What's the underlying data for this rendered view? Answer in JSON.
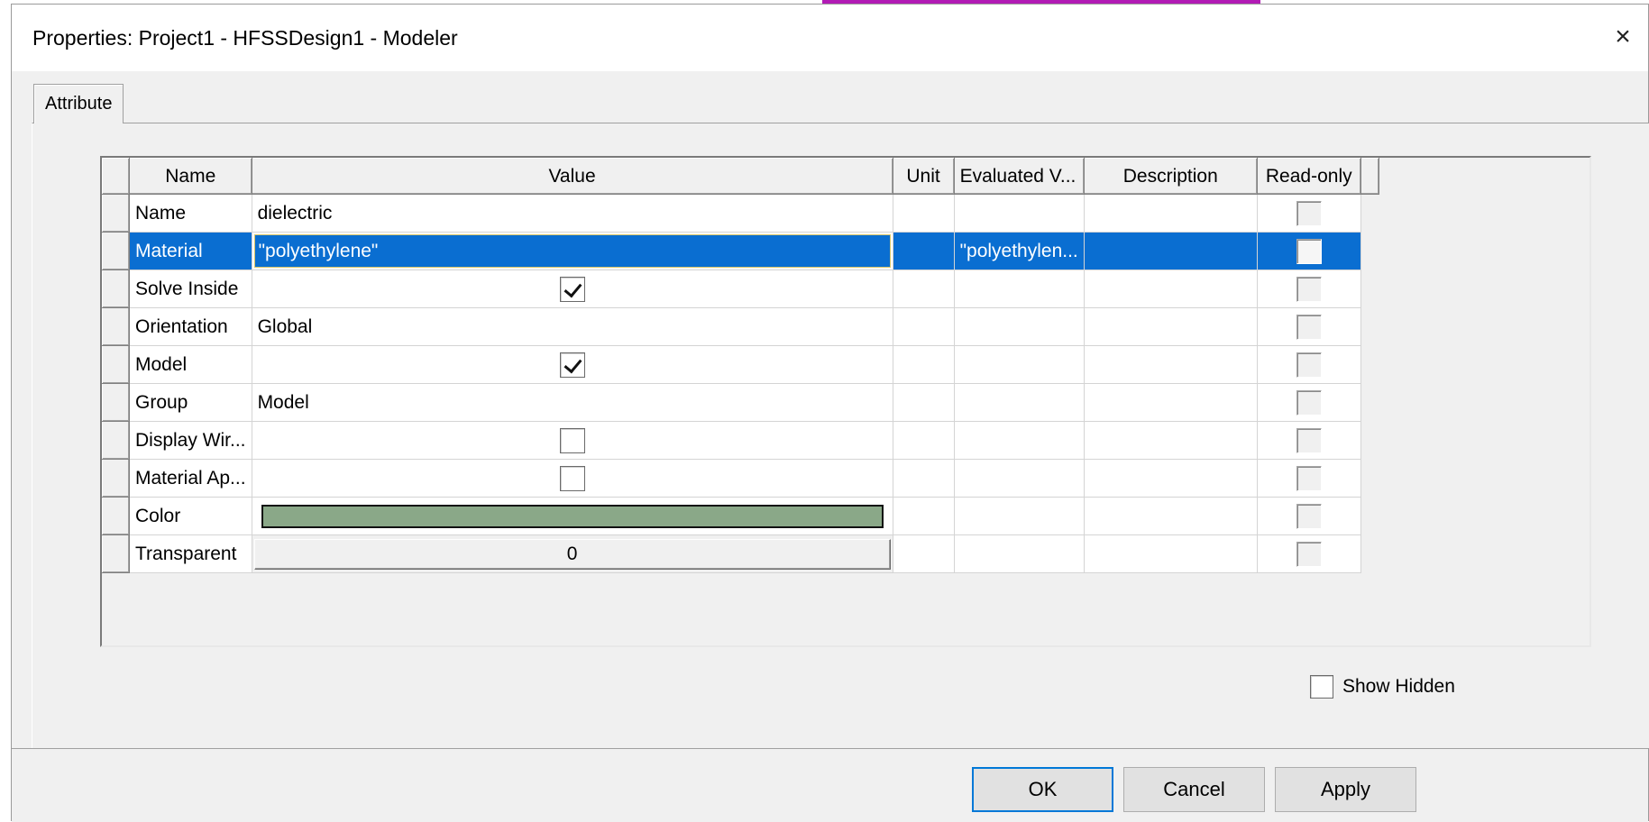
{
  "window": {
    "title": "Properties: Project1 - HFSSDesign1 - Modeler",
    "close_glyph": "×"
  },
  "tabs": [
    {
      "label": "Attribute",
      "active": true
    }
  ],
  "grid": {
    "columns": [
      "Name",
      "Value",
      "Unit",
      "Evaluated V...",
      "Description",
      "Read-only"
    ],
    "rows": [
      {
        "name": "Name",
        "value_type": "text",
        "value": "dielectric",
        "unit": "",
        "evaluated": "",
        "description": "",
        "read_only": false
      },
      {
        "name": "Material",
        "value_type": "edit",
        "value": "\"polyethylene\"",
        "unit": "",
        "evaluated": "\"polyethylen...",
        "description": "",
        "read_only": false,
        "selected": true
      },
      {
        "name": "Solve Inside",
        "value_type": "checkbox",
        "checked": true,
        "unit": "",
        "evaluated": "",
        "description": "",
        "read_only": false
      },
      {
        "name": "Orientation",
        "value_type": "text",
        "value": "Global",
        "unit": "",
        "evaluated": "",
        "description": "",
        "read_only": false
      },
      {
        "name": "Model",
        "value_type": "checkbox",
        "checked": true,
        "unit": "",
        "evaluated": "",
        "description": "",
        "read_only": false
      },
      {
        "name": "Group",
        "value_type": "text",
        "value": "Model",
        "unit": "",
        "evaluated": "",
        "description": "",
        "read_only": false
      },
      {
        "name": "Display Wir...",
        "value_type": "checkbox",
        "checked": false,
        "unit": "",
        "evaluated": "",
        "description": "",
        "read_only": false
      },
      {
        "name": "Material Ap...",
        "value_type": "checkbox",
        "checked": false,
        "unit": "",
        "evaluated": "",
        "description": "",
        "read_only": false
      },
      {
        "name": "Color",
        "value_type": "color",
        "color": "#8aa888",
        "unit": "",
        "evaluated": "",
        "description": "",
        "read_only": false
      },
      {
        "name": "Transparent",
        "value_type": "button",
        "value": "0",
        "unit": "",
        "evaluated": "",
        "description": "",
        "read_only": false
      }
    ]
  },
  "show_hidden": {
    "label": "Show Hidden",
    "checked": false
  },
  "buttons": {
    "ok": "OK",
    "cancel": "Cancel",
    "apply": "Apply"
  },
  "colors": {
    "selection": "#0a6ed1",
    "accent_strip": "#b21bb5",
    "default_button_border": "#0078d7"
  }
}
